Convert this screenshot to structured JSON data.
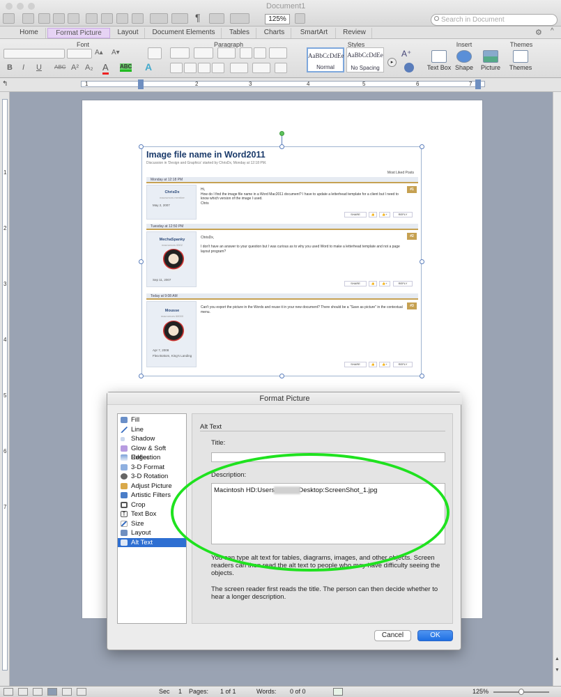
{
  "app": {
    "document_title": "Document1",
    "zoom": "125%",
    "search_placeholder": "Search in Document"
  },
  "ribbon_tabs": [
    "Home",
    "Format Picture",
    "Layout",
    "Document Elements",
    "Tables",
    "Charts",
    "SmartArt",
    "Review"
  ],
  "ribbon_groups": {
    "font": "Font",
    "paragraph": "Paragraph",
    "styles": "Styles",
    "insert": "Insert",
    "themes": "Themes"
  },
  "styles": [
    {
      "sample": "AaBbCcDdEe",
      "name": "Normal"
    },
    {
      "sample": "AaBbCcDdEe",
      "name": "No Spacing"
    }
  ],
  "insert_buttons": [
    "Text Box",
    "Shape",
    "Picture"
  ],
  "themes_button": "Themes",
  "ruler": {
    "numbers": [
      "1",
      "1",
      "2",
      "3",
      "4",
      "5",
      "6",
      "7"
    ],
    "vertical": [
      "1",
      "2",
      "3",
      "4",
      "5",
      "6",
      "7"
    ]
  },
  "picture": {
    "title": "Image file name in Word2011",
    "subtitle": "Discussion in 'Design and Graphics' started by ChrisDx, Monday at 12:18 PM.",
    "most_liked": "Most Liked Posts",
    "posts": [
      {
        "header": "Monday at 12:18 PM",
        "user": "ChrisDx",
        "role": "macrumors member",
        "date": "May 2, 2007",
        "num": "#1",
        "body": "Hi,\nHow do I find the image file name in a Word Mac2011 document? I have to update a letterhead template for a client but I need to know which version of the image I used.\nChris"
      },
      {
        "header": "Tuesday at 12:50 PM",
        "user": "MechaSpanky",
        "role": "macrumors 6502",
        "date": "Sep 11, 2007",
        "num": "#2",
        "body": "ChrisDx,\n\nI don't have an answer to your question but I was curious as to why you used Word to make a letterhead template and not a page layout program?"
      },
      {
        "header": "Today at 9:08 AM",
        "user": "Mousse",
        "role": "macrumors 68000",
        "date": "Apr 7, 2008",
        "location": "Flea Bottom, King's Landing",
        "num": "#3",
        "body": "Can't you export the picture in the Words and reuse it in your new document? There should be a \"Save as picture\" in the contextual menu."
      }
    ],
    "actions": [
      "SHARE",
      "👍",
      "👍+",
      "REPLY"
    ]
  },
  "dialog": {
    "title": "Format Picture",
    "categories": [
      "Fill",
      "Line",
      "Shadow",
      "Glow & Soft Edges",
      "Reflection",
      "3-D Format",
      "3-D Rotation",
      "Adjust Picture",
      "Artistic Filters",
      "Crop",
      "Text Box",
      "Size",
      "Layout",
      "Alt Text"
    ],
    "selected": "Alt Text",
    "section": "Alt Text",
    "title_label": "Title:",
    "title_value": "",
    "description_label": "Description:",
    "description_value": "Macintosh HD:Users:           :Desktop:ScreenShot_1.jpg",
    "help1": "You can type alt text for tables, diagrams, images, and other objects. Screen readers can then read the alt text to people who may have difficulty seeing the objects.",
    "help2": "The screen reader first reads the title. The person can then decide whether to hear a longer description.",
    "cancel": "Cancel",
    "ok": "OK"
  },
  "status": {
    "sec_label": "Sec",
    "sec_value": "1",
    "pages_label": "Pages:",
    "pages_value": "1 of 1",
    "words_label": "Words:",
    "words_value": "0 of 0",
    "zoom": "125%"
  },
  "colors": {
    "accent": "#2e6fd2",
    "annotation": "#1fe21f",
    "format_tab": "#e6d3f4",
    "post_gold": "#c6a152"
  }
}
